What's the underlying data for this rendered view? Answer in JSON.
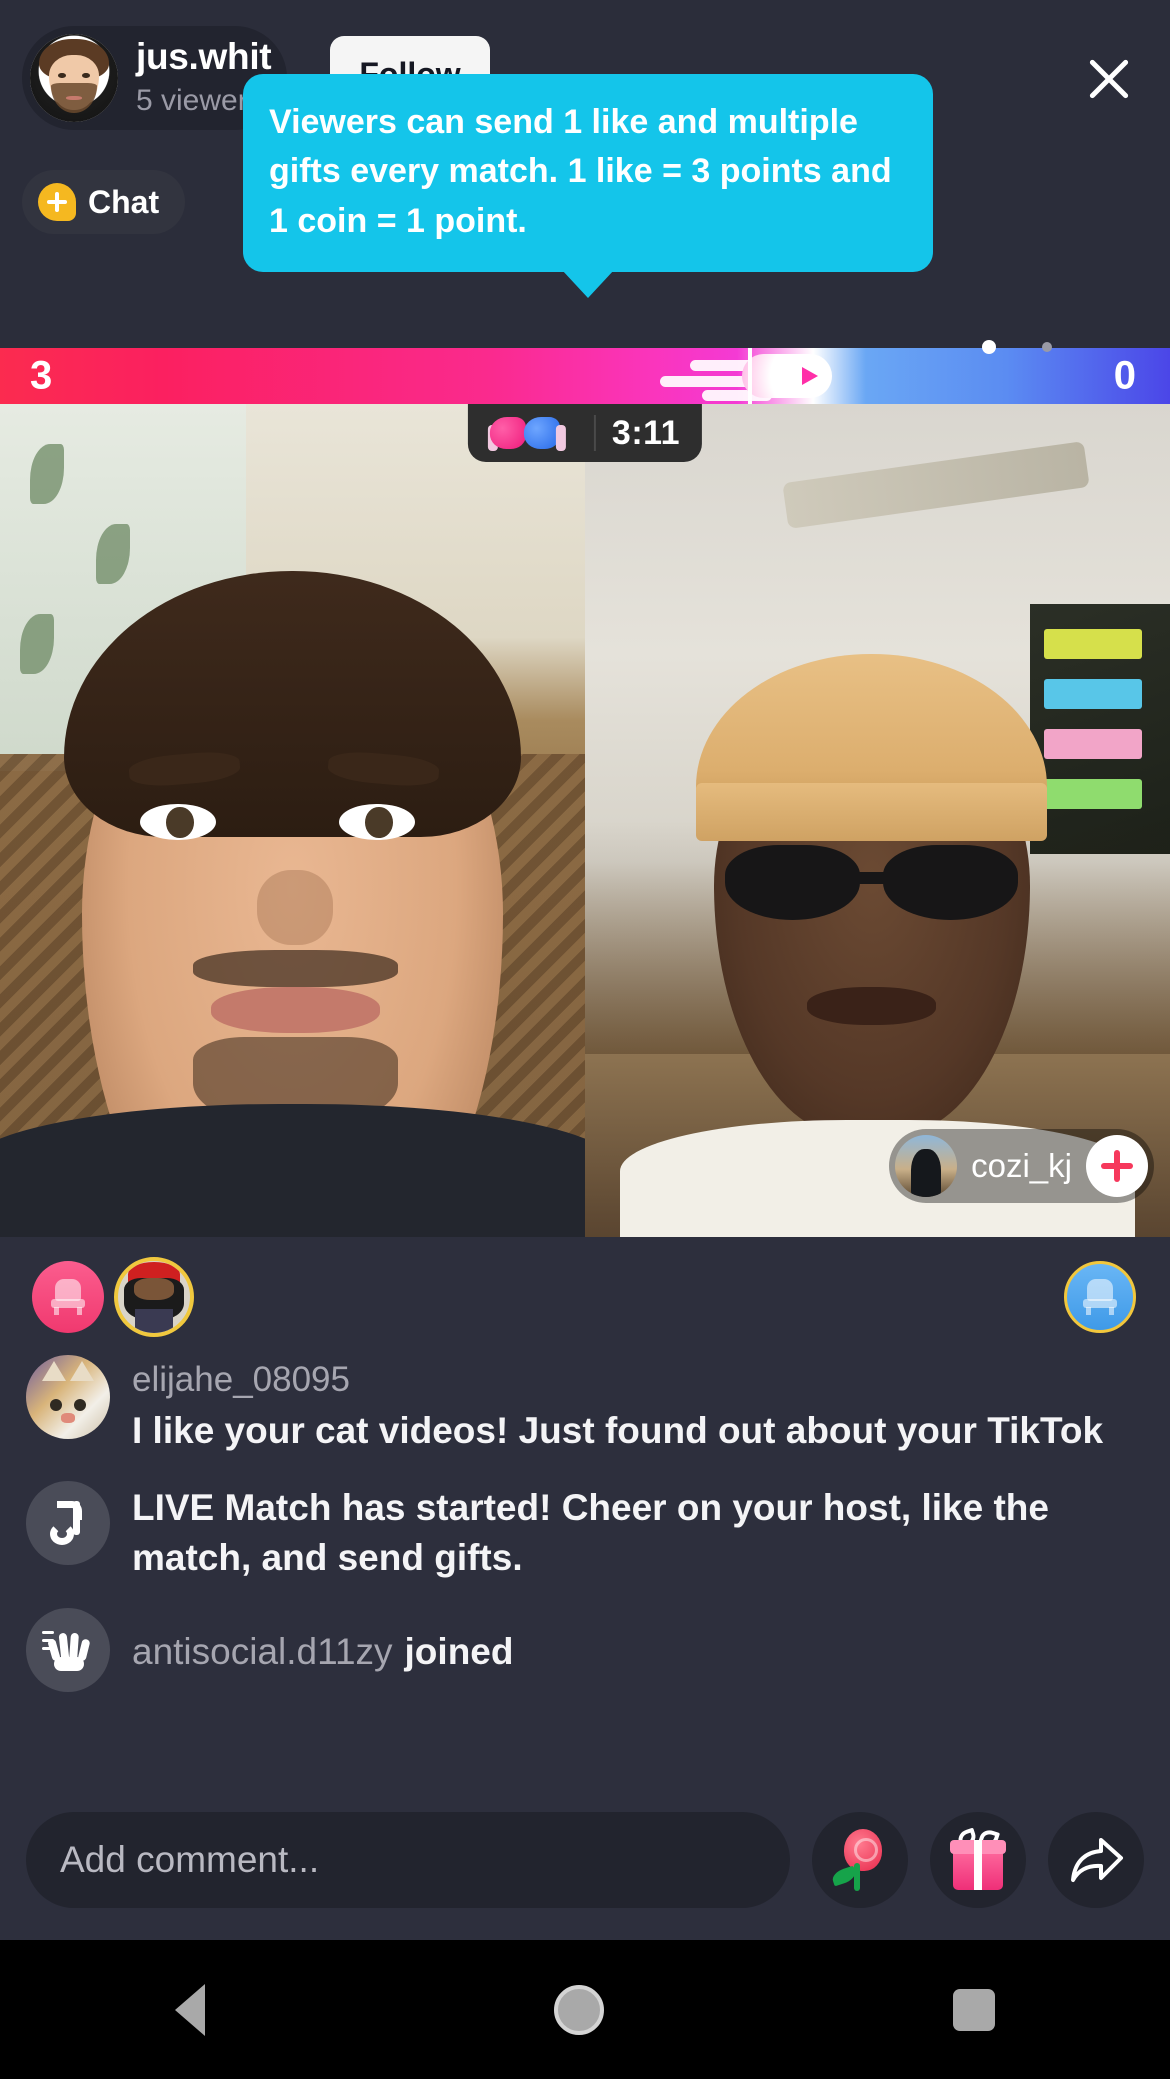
{
  "app": "TikTok LIVE Match",
  "header": {
    "host_username": "jus.whit",
    "viewer_count": "5 viewers",
    "follow_label": "Follow",
    "chat_chip_label": "Chat",
    "close_icon": "close-icon",
    "avatar_icon": "host-avatar"
  },
  "tooltip": {
    "text": "Viewers can send 1 like and multiple gifts every match.  1 like = 3 points and 1 coin = 1 point.",
    "background_color": "#14c5ea",
    "text_color": "#ffffff"
  },
  "scorebar": {
    "left_score": "3",
    "right_score": "0",
    "left_color": "#fb2b4f",
    "right_color": "#4b46e8",
    "marker_position_pct": 64
  },
  "match": {
    "timer": "3:11",
    "gloves_icon": "boxing-gloves-icon"
  },
  "guest": {
    "username": "cozi_kj",
    "follow_icon": "plus-icon"
  },
  "gifters": [
    {
      "name": "top-gifter-pink-throne",
      "icon": "throne-icon",
      "color": "#f0396f"
    },
    {
      "name": "top-gifter-avatar",
      "icon": "user-avatar"
    },
    {
      "name": "top-gifter-blue-throne",
      "icon": "throne-icon",
      "color": "#3f9ae8"
    }
  ],
  "chat": [
    {
      "type": "comment",
      "avatar_icon": "cat-avatar",
      "username": "elijahe_08095",
      "message": "I like your cat videos! Just found out about your TikTok"
    },
    {
      "type": "system",
      "avatar_icon": "tiktok-logo-icon",
      "message": "LIVE Match has started! Cheer on your host, like the match, and send gifts."
    },
    {
      "type": "join",
      "avatar_icon": "waving-hand-icon",
      "username": "antisocial.d11zy",
      "action": "joined"
    }
  ],
  "composer": {
    "placeholder": "Add comment...",
    "value": "",
    "actions": [
      {
        "name": "rose-gift-button",
        "icon": "rose-icon"
      },
      {
        "name": "gift-button",
        "icon": "gift-box-icon"
      },
      {
        "name": "share-button",
        "icon": "share-arrow-icon"
      }
    ]
  },
  "navbar": {
    "back": "back-icon",
    "home": "home-icon",
    "recents": "recents-icon"
  }
}
